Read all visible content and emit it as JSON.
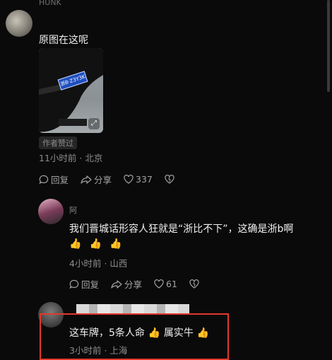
{
  "comments": [
    {
      "username": "HUNK",
      "text": "原图在这呢",
      "author_badge": "作者赞过",
      "time": "11小时前",
      "location": "北京",
      "actions": {
        "reply": "回复",
        "share": "分享",
        "likes": "337"
      }
    },
    {
      "username": "阿",
      "text": "我们晋城话形容人狂就是“浙比不下”，这确是浙b啊",
      "emojis": [
        "👍",
        "👍",
        "👍"
      ],
      "time": "4小时前",
      "location": "山西",
      "actions": {
        "reply": "回复",
        "share": "分享",
        "likes": "61"
      }
    },
    {
      "text_prefix": "这车牌，5条人命",
      "emoji_mid": "👍",
      "text_suffix": "属实牛",
      "emoji_end": "👍",
      "time": "3小时前",
      "location": "上海"
    }
  ],
  "photo": {
    "plate_text": "浙B·Z3Y3K"
  },
  "meta_separator": "·",
  "colors": {
    "highlight_box": "#e0392d",
    "background": "#0a0a0a"
  }
}
